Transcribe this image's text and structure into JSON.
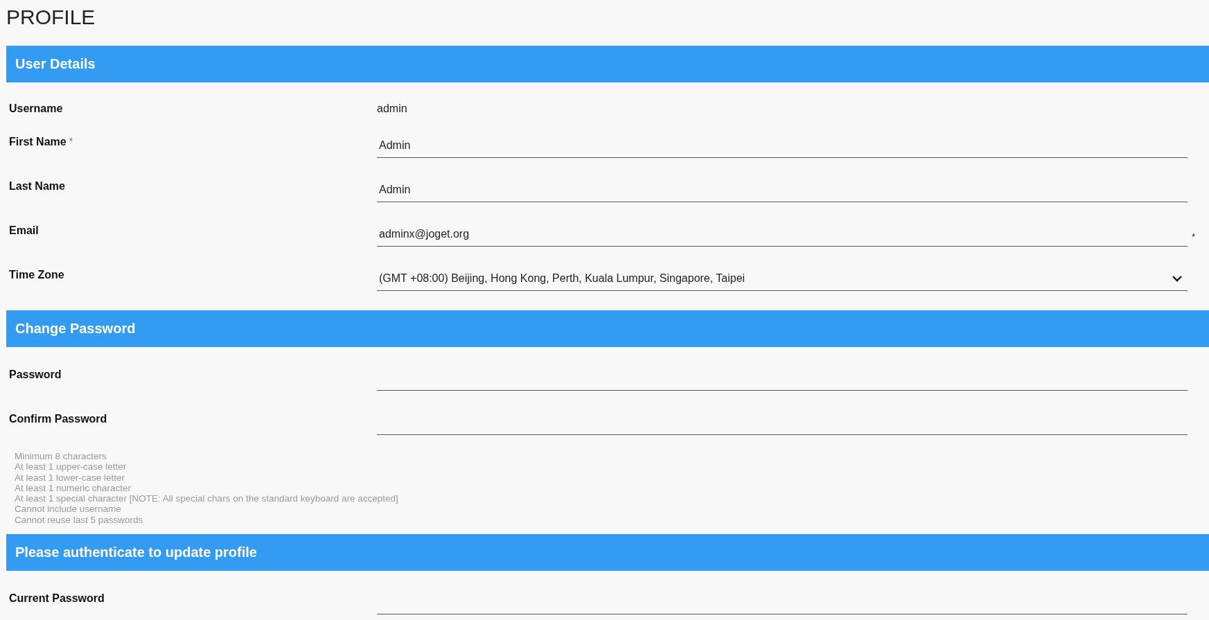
{
  "page_title": "PROFILE",
  "sections": [
    {
      "title": "User Details",
      "fields": [
        {
          "label": "Username",
          "kind": "static",
          "value": "admin",
          "required": false
        },
        {
          "label": "First Name",
          "kind": "input",
          "value": "Admin",
          "required": true
        },
        {
          "label": "Last Name",
          "kind": "input",
          "value": "Admin",
          "required": false
        },
        {
          "label": "Email",
          "kind": "input",
          "value": "adminx@joget.org",
          "required": false,
          "suffix": "*"
        },
        {
          "label": "Time Zone",
          "kind": "select",
          "value": "(GMT +08:00) Beijing, Hong Kong, Perth, Kuala Lumpur, Singapore, Taipei",
          "required": false
        }
      ]
    },
    {
      "title": "Change Password",
      "fields": [
        {
          "label": "Password",
          "kind": "password",
          "required": false
        },
        {
          "label": "Confirm Password",
          "kind": "password",
          "required": false
        }
      ],
      "notes": [
        "Minimum 8 characters",
        "At least 1 upper-case letter",
        "At least 1 lower-case letter",
        "At least 1 numeric character",
        "At least 1 special character [NOTE: All special chars on the standard keyboard are accepted]",
        "Cannot include username",
        "Cannot reuse last 5 passwords"
      ]
    },
    {
      "title": "Please authenticate to update profile",
      "fields": [
        {
          "label": "Current Password",
          "kind": "password",
          "required": false
        }
      ]
    }
  ]
}
